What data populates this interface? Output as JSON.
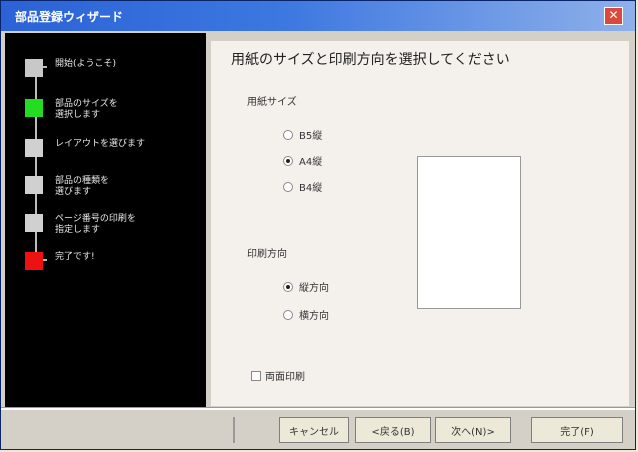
{
  "window": {
    "title": "部品登録ウィザード",
    "close_glyph": "✕"
  },
  "steps": [
    {
      "label": "開始(ようこそ)",
      "color": "#c8c8c8"
    },
    {
      "label": "部品のサイズを\n選択します",
      "color": "#22dd22"
    },
    {
      "label": "レイアウトを選びます",
      "color": "#d0d0d0"
    },
    {
      "label": "部品の種類を\n選びます",
      "color": "#d0d0d0"
    },
    {
      "label": "ページ番号の印刷を\n指定します",
      "color": "#d0d0d0"
    },
    {
      "label": "完了です!",
      "color": "#ee1111"
    }
  ],
  "main": {
    "heading": "用紙のサイズと印刷方向を選択してください",
    "size_label": "用紙サイズ",
    "sizes": [
      {
        "label": "B5縦",
        "selected": false
      },
      {
        "label": "A4縦",
        "selected": true
      },
      {
        "label": "B4縦",
        "selected": false
      }
    ],
    "orientation_label": "印刷方向",
    "orientations": [
      {
        "label": "縦方向",
        "selected": true
      },
      {
        "label": "横方向",
        "selected": false
      }
    ],
    "checkbox_label": "両面印刷"
  },
  "footer": {
    "cancel": "キャンセル",
    "back": "<戻る(B)",
    "next": "次へ(N)>",
    "finish": "完了(F)"
  }
}
